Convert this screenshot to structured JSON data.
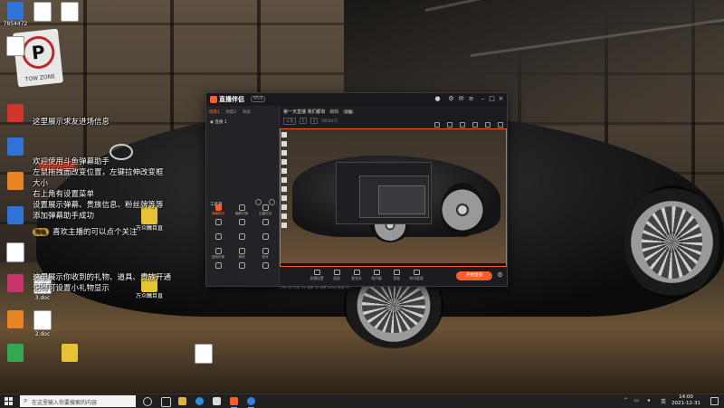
{
  "desktop": {
    "icons": [
      {
        "label": "7854472",
        "color": "g-blue"
      },
      {
        "label": "",
        "color": "g-doc"
      },
      {
        "label": "",
        "color": "g-doc"
      },
      {
        "label": "",
        "color": "g-doc"
      },
      {
        "label": "",
        "color": "g-red"
      },
      {
        "label": "",
        "color": "g-blue"
      },
      {
        "label": "",
        "color": "g-orange"
      },
      {
        "label": "",
        "color": "g-blue"
      },
      {
        "label": "",
        "color": "g-doc"
      },
      {
        "label": "",
        "color": "g-pink"
      },
      {
        "label": "",
        "color": "g-orange"
      },
      {
        "label": "",
        "color": "g-green"
      },
      {
        "label": "2.doc",
        "color": "g-doc"
      },
      {
        "label": "3.doc",
        "color": "g-doc"
      },
      {
        "label": "",
        "color": "g-yellow"
      },
      {
        "label": "万众瞩目直播 1403",
        "color": "g-yellow"
      },
      {
        "label": "万众瞩目直播",
        "color": "g-yellow"
      },
      {
        "label": "",
        "color": "g-doc"
      }
    ],
    "sign": {
      "text": "TOW ZONE"
    }
  },
  "chat": {
    "lines": [
      "这里展示求友进场信息",
      "欢迎使用斗鱼弹幕助手",
      "左鼠拖拽面改变位置，左键拉伸改变框",
      "大小",
      "右上角有设置菜单",
      "设置展示弹幕、贵族信息、粉丝牌等等",
      "添加弹幕助手成功",
      "喜欢主播的可以点个关注",
      "这里展示你收到的礼物、道具、贵族开通",
      "记得可设置小礼物显示"
    ],
    "tag": "降临"
  },
  "app": {
    "name": "直播伴侣",
    "version": "V5.0",
    "left_tabs": [
      "场景1",
      "场景2",
      "添加"
    ],
    "scene_label": "直播 1",
    "section_title": "工具箱",
    "tools": [
      "弹幕助手",
      "横屏切换",
      "主播任务",
      "",
      "",
      "",
      "",
      "",
      "",
      "虚拟形象",
      "美颜",
      "音效",
      "",
      "",
      ""
    ],
    "stream_title": "第一天直播 我们都有",
    "edit_label": "编辑",
    "badge": "开播",
    "stats": [
      "斗鱼",
      "0",
      "0",
      "7854472"
    ],
    "bottom_items": [
      "直播设置",
      "画面",
      "麦克风",
      "扬声器",
      "音效",
      "房间管理"
    ],
    "start_button": "开始直播",
    "status": "CPU 0% 内存 0% 帧率 30 码率 0Kb/s 丢帧 0%"
  },
  "taskbar": {
    "search_placeholder": "在这里输入你要搜索的内容",
    "clock_time": "14:00",
    "clock_date": "2021-12-31",
    "tray_lang": "英"
  }
}
